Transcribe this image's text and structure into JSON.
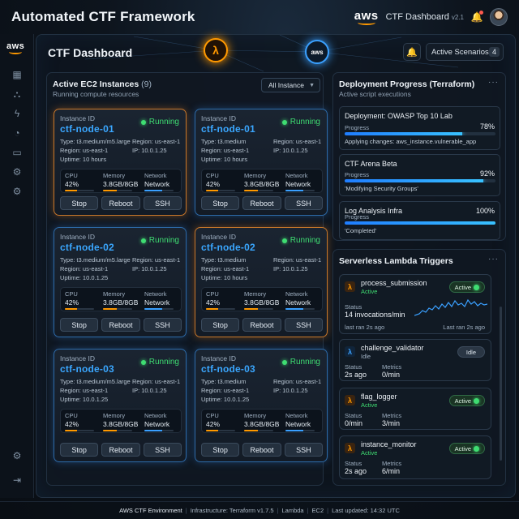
{
  "header": {
    "title": "Automated CTF Framework",
    "brand": "aws",
    "dashboard_label": "CTF Dashboard",
    "version": "v2.1"
  },
  "main": {
    "title": "CTF Dashboard",
    "active_scenarios_label": "Active Scenarios",
    "active_scenarios_count": "4",
    "node_lambda_symbol": "λ",
    "node_aws_label": "aws"
  },
  "ec2": {
    "title": "Active EC2 Instances",
    "count": "(9)",
    "subtitle": "Running compute resources",
    "filter": "All Instance",
    "labels": {
      "instance_id": "Instance ID",
      "cpu": "CPU",
      "memory": "Memory",
      "network": "Network"
    },
    "buttons": {
      "stop": "Stop",
      "reboot": "Reboot",
      "ssh": "SSH"
    },
    "cards": [
      {
        "name": "ctf-node-01",
        "status": "Running",
        "type": "Type: t3.medium/m5.large",
        "region": "Region: us-east-1",
        "region2": "Region: us-east-1",
        "ip": "IP: 10.0.1.25",
        "uptime": "Uptime: 10 hours",
        "cpu": "42%",
        "cpu_pct": 42,
        "memory": "3.8GB/8GB",
        "mem_pct": 47,
        "network": "Network",
        "net_pct": 60
      },
      {
        "name": "ctf-node-01",
        "status": "Running",
        "type": "Type: t3.medium",
        "region": "Region: us-east-1",
        "region2": "Region: us-east-1",
        "ip": "IP: 10.0.1.25",
        "uptime": "Uptime: 10 hours",
        "cpu": "42%",
        "cpu_pct": 42,
        "memory": "3.8GB/8GB",
        "mem_pct": 47,
        "network": "Network",
        "net_pct": 60
      },
      {
        "name": "ctf-node-02",
        "status": "Running",
        "type": "Type: t3.medium/m5.large",
        "region": "Region: us-east-1",
        "region2": "Region: us-east-1",
        "ip": "IP: 10.0.1.25",
        "uptime": "Uptime: 10.0.1.25",
        "cpu": "42%",
        "cpu_pct": 42,
        "memory": "3.8GB/8GB",
        "mem_pct": 47,
        "network": "Network",
        "net_pct": 60
      },
      {
        "name": "ctf-node-02",
        "status": "Running",
        "type": "Type: t3.medium",
        "region": "Region: us-east-1",
        "region2": "Region: us-east-1",
        "ip": "IP: 10.0.1.25",
        "uptime": "Uptime: 10 hours",
        "cpu": "42%",
        "cpu_pct": 42,
        "memory": "3.8GB/8GB",
        "mem_pct": 47,
        "network": "Network",
        "net_pct": 60
      },
      {
        "name": "ctf-node-03",
        "status": "Running",
        "type": "Type: t3.medium/m5.large",
        "region": "Region: us-east-1",
        "region2": "Region: us-east-1",
        "ip": "IP: 10.0.1.25",
        "uptime": "Uptime: 10.0.1.25",
        "cpu": "42%",
        "cpu_pct": 42,
        "memory": "3.8GB/8GB",
        "mem_pct": 47,
        "network": "Network",
        "net_pct": 60
      },
      {
        "name": "ctf-node-03",
        "status": "Running",
        "type": "Type: t3.medium",
        "region": "Region: us-east-1",
        "region2": "Region: us-east-1",
        "ip": "IP: 10.0.1.25",
        "uptime": "Uptime: 10.0.1.25",
        "cpu": "42%",
        "cpu_pct": 42,
        "memory": "3.8GB/8GB",
        "mem_pct": 47,
        "network": "Network",
        "net_pct": 60
      }
    ]
  },
  "deploy": {
    "title": "Deployment Progress (Terraform)",
    "subtitle": "Active script executions",
    "items": [
      {
        "name": "Deployment: OWASP Top 10 Lab",
        "progress_label": "Progress",
        "value": "78%",
        "pct": 78,
        "status": "Applying changes: aws_instance.vulnerable_app"
      },
      {
        "name": "CTF Arena Beta",
        "progress_label": "Progress",
        "value": "92%",
        "pct": 92,
        "status": "'Modifying Security Groups'"
      },
      {
        "name": "Log Analysis Infra",
        "progress_label": "Progress",
        "value": "100%",
        "pct": 100,
        "status": "'Completed'"
      }
    ]
  },
  "lambda": {
    "title": "Serverless Lambda Triggers",
    "items": [
      {
        "name": "process_submission",
        "state": "Active",
        "badge": "Active",
        "status_label": "Status",
        "status_value": "14 invocations/min",
        "last_left": "last ran 2s ago",
        "last_right": "Last ran 2s ago"
      },
      {
        "name": "challenge_validator",
        "state": "Idle",
        "badge": "Idle",
        "status_label": "Status",
        "status_value": "2s ago",
        "metrics_label": "Metrics",
        "metrics_value": "0/min"
      },
      {
        "name": "flag_logger",
        "state": "Active",
        "badge": "Active",
        "status_label": "Status",
        "status_value": "0/min",
        "metrics_label": "Metrics",
        "metrics_value": "3/min"
      },
      {
        "name": "instance_monitor",
        "state": "Active",
        "badge": "Active",
        "status_label": "Status",
        "status_value": "2s ago",
        "metrics_label": "Metrics",
        "metrics_value": "6/min"
      }
    ]
  },
  "footer": {
    "items": [
      "AWS CTF Environment",
      "Infrastructure: Terraform v1.7.5",
      "Lambda",
      "EC2",
      "Last updated: 14:32 UTC"
    ]
  },
  "colors": {
    "accent_orange": "#ff9900",
    "accent_blue": "#3aa0ff",
    "running_green": "#3fdd72"
  },
  "icons": {
    "sidebar": [
      "aws-logo",
      "grid-icon",
      "network-icon",
      "lambda-bolt-icon",
      "dashboard-gauge-icon",
      "folder-icon",
      "settings-icon",
      "settings-icon-2",
      "gear-icon",
      "logout-icon"
    ]
  }
}
